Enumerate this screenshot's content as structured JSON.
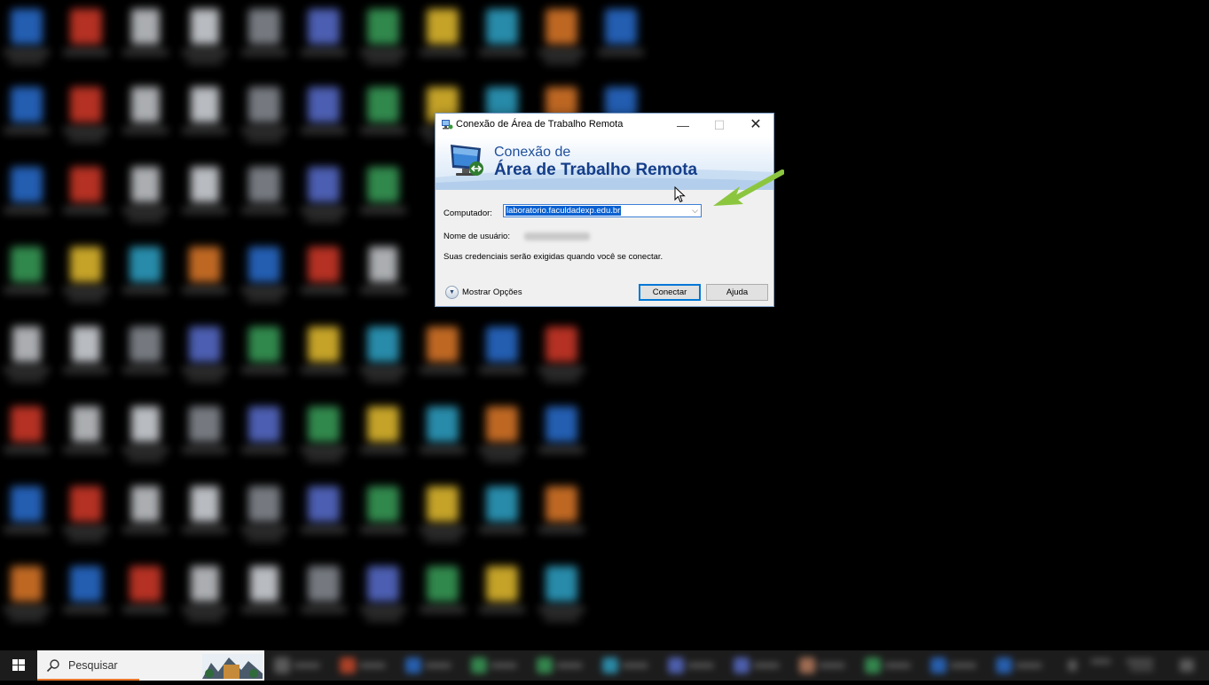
{
  "dialog": {
    "title": "Conexão de Área de Trabalho Remota",
    "banner_line1": "Conexão de",
    "banner_line2": "Área de Trabalho Remota",
    "computer_label": "Computador:",
    "computer_value": "laboratorio.faculdadexp.edu.br",
    "username_label": "Nome de usuário:",
    "credentials_note": "Suas credenciais serão exigidas quando você se conectar.",
    "show_options": "Mostrar Opções",
    "connect_button": "Conectar",
    "help_button": "Ajuda",
    "close_glyph": "✕",
    "minimize_glyph": "—",
    "maximize_glyph": "☐",
    "combo_arrow": "⌵"
  },
  "taskbar": {
    "search_placeholder": "Pesquisar"
  },
  "colors": {
    "annotation_arrow": "#8cc63f",
    "banner_text": "#153e8a",
    "selection": "#0a60d0",
    "taskbar": "#1c1c1c"
  },
  "icons": {
    "window_icon": "remote-desktop-icon",
    "banner_icon": "monitor-connection-icon",
    "start": "windows-logo-icon",
    "search": "search-icon",
    "options": "chevron-down-icon"
  }
}
